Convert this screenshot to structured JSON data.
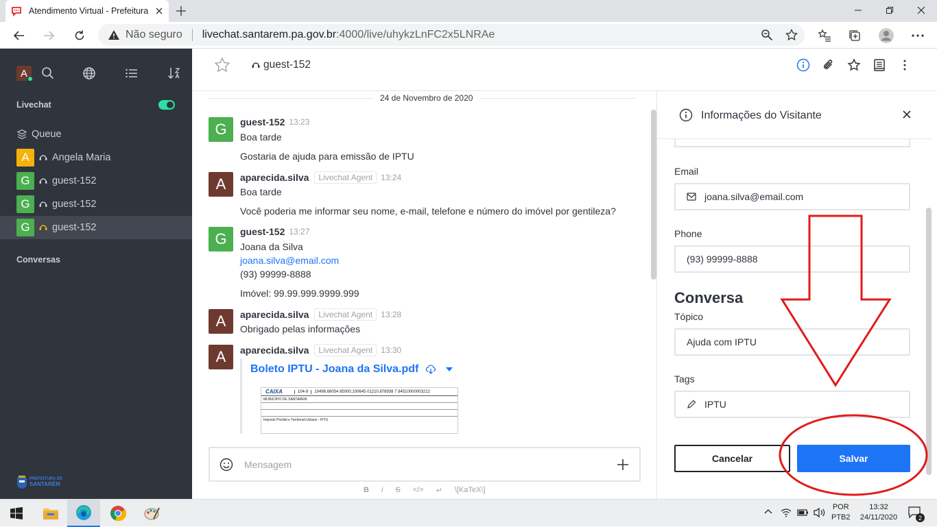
{
  "browser": {
    "tab_title": "Atendimento Virtual - Prefeitura",
    "security_label": "Não seguro",
    "url_host": "livechat.santarem.pa.gov.br",
    "url_path": ":4000/live/uhykzLnFC2x5LNRAe"
  },
  "sidebar": {
    "user_initial": "A",
    "livechat_label": "Livechat",
    "queue_label": "Queue",
    "rooms": [
      {
        "initial": "A",
        "name": "Angela Maria",
        "color": "#f5b30a"
      },
      {
        "initial": "G",
        "name": "guest-152",
        "color": "#4caf50"
      },
      {
        "initial": "G",
        "name": "guest-152",
        "color": "#4caf50"
      },
      {
        "initial": "G",
        "name": "guest-152",
        "color": "#4caf50"
      }
    ],
    "conversas_label": "Conversas",
    "logo_text_1": "PREFEITURA DE",
    "logo_text_2": "SANTARÉM"
  },
  "header": {
    "room_name": "guest-152"
  },
  "chat": {
    "date": "24 de Novembro de 2020",
    "messages": [
      {
        "initial": "G",
        "user": "guest-152",
        "time": "13:23",
        "lines": [
          "Boa tarde",
          "Gostaria de ajuda para emissão de IPTU"
        ]
      },
      {
        "initial": "A",
        "user": "aparecida.silva",
        "role": "Livechat Agent",
        "time": "13:24",
        "lines": [
          "Boa tarde",
          "Você poderia me informar seu nome, e-mail, telefone e número do imóvel por gentileza?"
        ]
      },
      {
        "initial": "G",
        "user": "guest-152",
        "time": "13:27",
        "lines": [
          "Joana da Silva",
          "joana.silva@email.com",
          "(93) 99999-8888",
          "Imóvel: 99.99.999.9999.999"
        ]
      },
      {
        "initial": "A",
        "user": "aparecida.silva",
        "role": "Livechat Agent",
        "time": "13:28",
        "lines": [
          "Obrigado pelas informações"
        ]
      },
      {
        "initial": "A",
        "user": "aparecida.silva",
        "role": "Livechat Agent",
        "time": "13:30",
        "attachment": "Boleto IPTU - Joana da Silva.pdf"
      }
    ],
    "doc_preview": {
      "bank": "CAIXA",
      "bank_code": "104-9",
      "barcode_line": "10496.68054 85000.100645 01210.878938 7 84510000003212",
      "beneficiary": "MUNICIPIO DE SANTAREM",
      "description": "Imposto Predial e Territorial Urbano - IPTU"
    },
    "composer_placeholder": "Mensagem",
    "format_items": [
      "B",
      "i",
      "S",
      "</>",
      "↵",
      "\\[KaTeX\\]"
    ]
  },
  "panel": {
    "title": "Informações do Visitante",
    "email_label": "Email",
    "email_value": "joana.silva@email.com",
    "phone_label": "Phone",
    "phone_value": "(93) 99999-8888",
    "section_title": "Conversa",
    "topic_label": "Tópico",
    "topic_value": "Ajuda com IPTU",
    "tags_label": "Tags",
    "tags_value": "IPTU",
    "cancel_label": "Cancelar",
    "save_label": "Salvar"
  },
  "taskbar": {
    "lang_1": "POR",
    "lang_2": "PTB2",
    "time": "13:32",
    "date": "24/11/2020",
    "notif_count": "2"
  },
  "colors": {
    "accent": "#1d74f5",
    "sidebar_bg": "#2f343d",
    "annotation_red": "#e01b1b",
    "toggle_green": "#2de0a5"
  }
}
